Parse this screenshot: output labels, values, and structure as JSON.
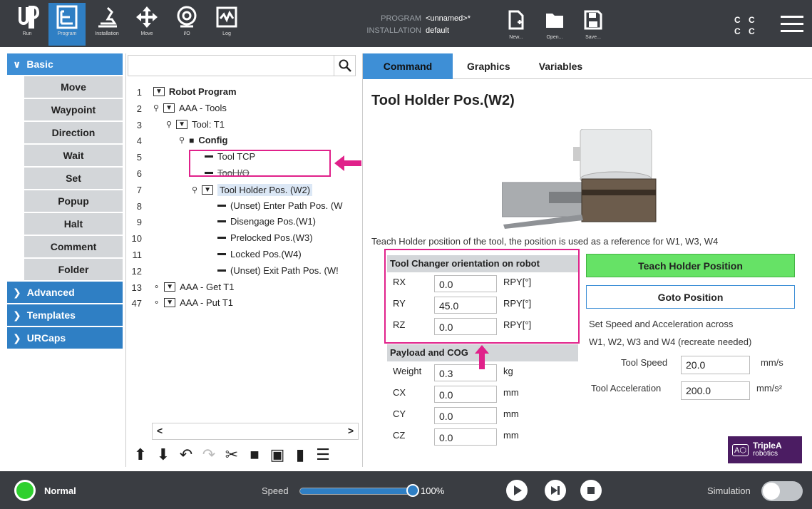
{
  "nav": [
    {
      "label": "Run",
      "icon": "ur-logo-icon"
    },
    {
      "label": "Program",
      "icon": "program-icon",
      "active": true
    },
    {
      "label": "Installation",
      "icon": "installation-icon"
    },
    {
      "label": "Move",
      "icon": "move-icon"
    },
    {
      "label": "I/O",
      "icon": "io-icon"
    },
    {
      "label": "Log",
      "icon": "log-icon"
    }
  ],
  "program_info": {
    "program_key": "PROGRAM",
    "program_value": "<unnamed>*",
    "installation_key": "INSTALLATION",
    "installation_value": "default"
  },
  "file_buttons": [
    {
      "label": "New...",
      "icon": "new-file-icon"
    },
    {
      "label": "Open...",
      "icon": "open-folder-icon"
    },
    {
      "label": "Save...",
      "icon": "save-icon"
    }
  ],
  "cc": {
    "line1": "C C",
    "line2": "C C"
  },
  "sidebar": {
    "basic": "Basic",
    "basic_items": [
      "Move",
      "Waypoint",
      "Direction",
      "Wait",
      "Set",
      "Popup",
      "Halt",
      "Comment",
      "Folder"
    ],
    "advanced": "Advanced",
    "templates": "Templates",
    "urcaps": "URCaps"
  },
  "tree": {
    "rows": [
      {
        "num": "1",
        "label": "Robot Program"
      },
      {
        "num": "2",
        "label": "AAA - Tools"
      },
      {
        "num": "3",
        "label": "Tool: T1"
      },
      {
        "num": "4",
        "label": "Config"
      },
      {
        "num": "5",
        "label": "Tool TCP"
      },
      {
        "num": "6",
        "label": "Tool I/O"
      },
      {
        "num": "7",
        "label": "Tool Holder Pos. (W2)"
      },
      {
        "num": "8",
        "label": "(Unset) Enter Path Pos. (W"
      },
      {
        "num": "9",
        "label": "Disengage Pos.(W1)"
      },
      {
        "num": "10",
        "label": "Prelocked Pos.(W3)"
      },
      {
        "num": "11",
        "label": "Locked Pos.(W4)"
      },
      {
        "num": "12",
        "label": "(Unset) Exit Path Pos. (W!"
      },
      {
        "num": "13",
        "label": "AAA - Get T1"
      },
      {
        "num": "47",
        "label": "AAA - Put T1"
      }
    ]
  },
  "tabs": [
    "Command",
    "Graphics",
    "Variables"
  ],
  "command": {
    "title": "Tool Holder Pos.(W2)",
    "description": "Teach Holder position of the tool, the position is used as a reference for W1, W3, W4",
    "orientation": {
      "header": "Tool Changer orientation on robot",
      "rows": [
        {
          "name": "RX",
          "value": "0.0",
          "unit": "RPY[°]"
        },
        {
          "name": "RY",
          "value": "45.0",
          "unit": "RPY[°]"
        },
        {
          "name": "RZ",
          "value": "0.0",
          "unit": "RPY[°]"
        }
      ]
    },
    "payload": {
      "header": "Payload and COG",
      "rows": [
        {
          "name": "Weight",
          "value": "0.3",
          "unit": "kg"
        },
        {
          "name": "CX",
          "value": "0.0",
          "unit": "mm"
        },
        {
          "name": "CY",
          "value": "0.0",
          "unit": "mm"
        },
        {
          "name": "CZ",
          "value": "0.0",
          "unit": "mm"
        }
      ]
    },
    "teach_button": "Teach Holder Position",
    "goto_button": "Goto Position",
    "speed_desc_1": "Set Speed and Acceleration across",
    "speed_desc_2": "W1, W2, W3 and W4 (recreate needed)",
    "tool_speed_label": "Tool Speed",
    "tool_speed_value": "20.0",
    "tool_speed_unit": "mm/s",
    "tool_accel_label": "Tool Acceleration",
    "tool_accel_value": "200.0",
    "tool_accel_unit": "mm/s²",
    "logo_line1": "TripleA",
    "logo_line2": "robotics"
  },
  "bottom": {
    "status": "Normal",
    "speed_label": "Speed",
    "speed_value": "100%",
    "simulation_label": "Simulation"
  },
  "colors": {
    "topbar": "#3a3d42",
    "accent_blue": "#2f7fc4",
    "highlight_pink": "#e0218a",
    "teach_green": "#66e266"
  }
}
